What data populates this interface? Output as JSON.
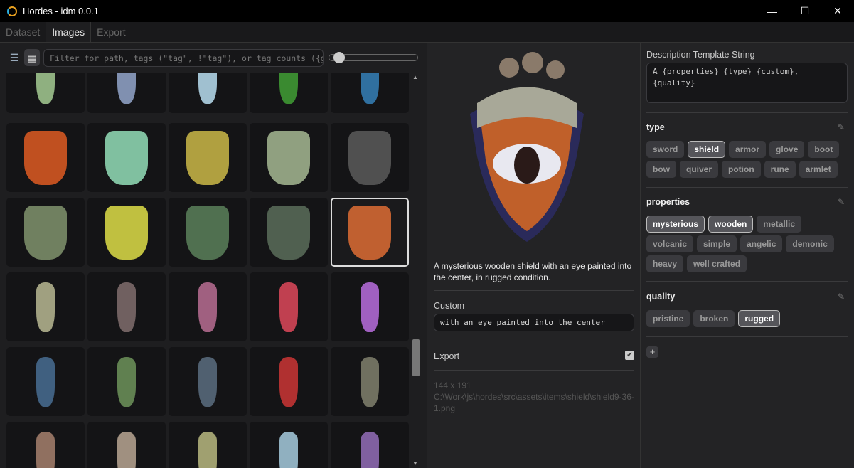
{
  "window": {
    "title": "Hordes - idm 0.0.1"
  },
  "tabs": [
    {
      "label": "Dataset"
    },
    {
      "label": "Images"
    },
    {
      "label": "Export"
    }
  ],
  "toolbar": {
    "filter_placeholder": "Filter for path, tags (\"tag\", !\"tag\"), or tag counts ({gr"
  },
  "grid": {
    "rows": [
      [
        "#8fb080",
        "#8090b0",
        "#a0c0d0",
        "#3a8a30",
        "#3070a0"
      ],
      [
        "#c05020",
        "#80c0a0",
        "#b0a040",
        "#90a080",
        "#505050"
      ],
      [
        "#708060",
        "#c0c040",
        "#507050",
        "#506050",
        "#c06030"
      ],
      [
        "#a0a080",
        "#706060",
        "#a06080",
        "#c04050",
        "#a060c0"
      ],
      [
        "#406080",
        "#608050",
        "#506070",
        "#b03030",
        "#707060"
      ],
      [
        "#907060",
        "#a09080",
        "#a0a070",
        "#90b0c0",
        "#8060a0"
      ]
    ],
    "selected_row": 2,
    "selected_col": 4
  },
  "detail": {
    "description": "A mysterious wooden shield with an eye painted into the center, in rugged condition.",
    "custom_label": "Custom",
    "custom_value": "with an eye painted into the center",
    "export_label": "Export",
    "export_checked": true,
    "dimensions": "144 x 191",
    "path": "C:\\Work\\js\\hordes\\src\\assets\\items\\shield\\shield9-36-1.png"
  },
  "right": {
    "template_label": "Description Template String",
    "template_value": "A {properties} {type} {custom}, {quality}",
    "sections": [
      {
        "name": "type",
        "tags": [
          {
            "label": "sword",
            "on": false
          },
          {
            "label": "shield",
            "on": true
          },
          {
            "label": "armor",
            "on": false
          },
          {
            "label": "glove",
            "on": false
          },
          {
            "label": "boot",
            "on": false
          },
          {
            "label": "bow",
            "on": false
          },
          {
            "label": "quiver",
            "on": false
          },
          {
            "label": "potion",
            "on": false
          },
          {
            "label": "rune",
            "on": false
          },
          {
            "label": "armlet",
            "on": false
          }
        ]
      },
      {
        "name": "properties",
        "tags": [
          {
            "label": "mysterious",
            "on": true
          },
          {
            "label": "wooden",
            "on": true
          },
          {
            "label": "metallic",
            "on": false
          },
          {
            "label": "volcanic",
            "on": false
          },
          {
            "label": "simple",
            "on": false
          },
          {
            "label": "angelic",
            "on": false
          },
          {
            "label": "demonic",
            "on": false
          },
          {
            "label": "heavy",
            "on": false
          },
          {
            "label": "well crafted",
            "on": false
          }
        ]
      },
      {
        "name": "quality",
        "tags": [
          {
            "label": "pristine",
            "on": false
          },
          {
            "label": "broken",
            "on": false
          },
          {
            "label": "rugged",
            "on": true
          }
        ]
      }
    ]
  }
}
